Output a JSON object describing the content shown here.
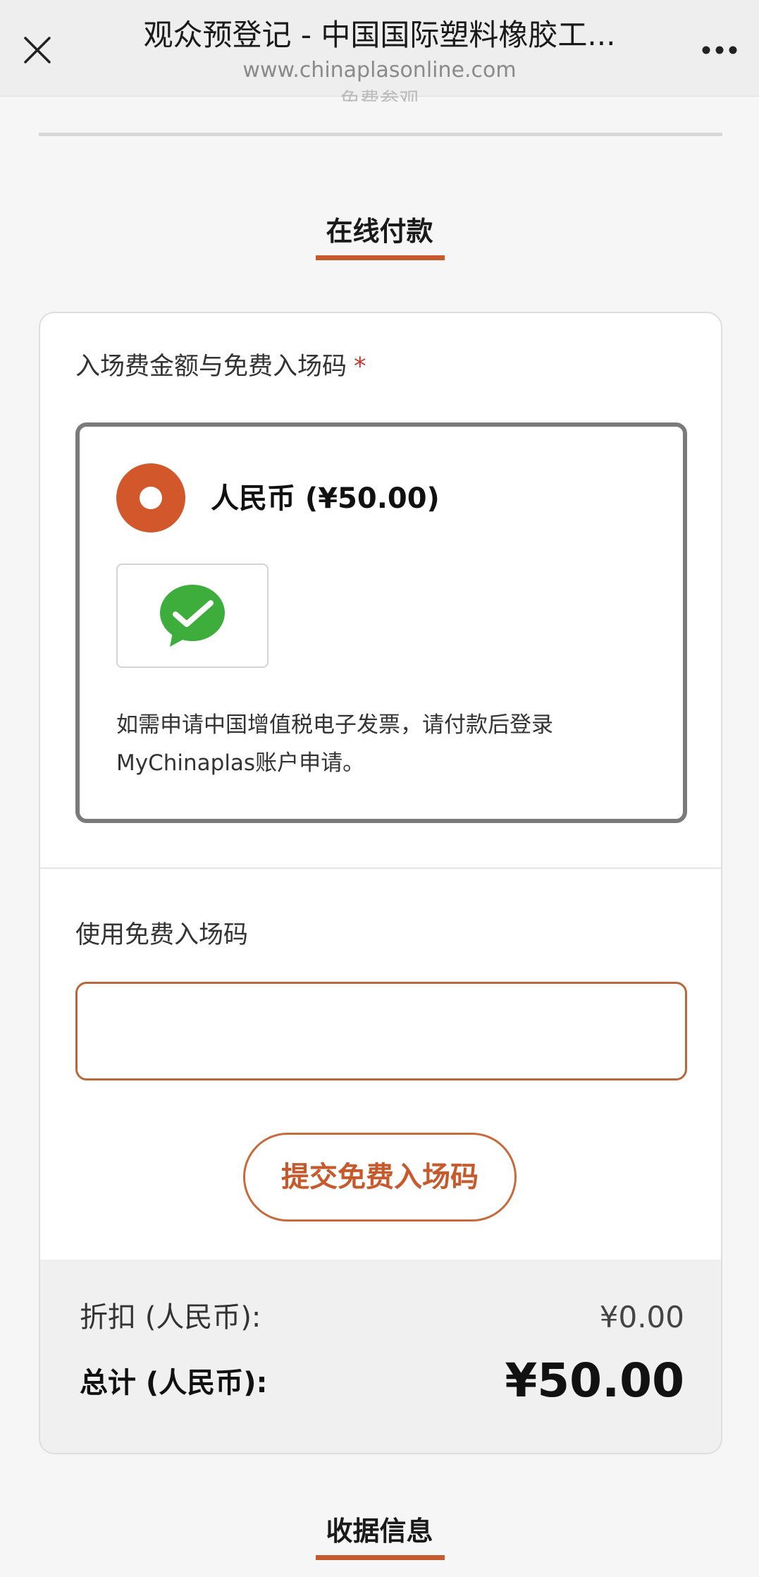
{
  "topbar": {
    "title": "观众预登记 - 中国国际塑料橡胶工...",
    "url": "www.chinaplasonline.com",
    "cutoff_text": "免费参观"
  },
  "payment": {
    "heading": "在线付款",
    "fee_label": "入场费金额与免费入场码",
    "required_mark": "*",
    "option_label": "人民币 (¥50.00)",
    "invoice_note": "如需申请中国增值税电子发票，请付款后登录MyChinaplas账户申请。",
    "free_code_label": "使用免费入场码",
    "free_code_value": "",
    "submit_label": "提交免费入场码"
  },
  "summary": {
    "discount_label": "折扣 (人民币):",
    "discount_value": "¥0.00",
    "total_label": "总计 (人民币):",
    "total_value": "¥50.00"
  },
  "receipt": {
    "heading": "收据信息"
  },
  "colors": {
    "accent": "#d2582b",
    "wechat_green": "#3dad3b"
  },
  "icons": {
    "close": "close-icon",
    "more": "more-dots-icon",
    "wechat": "wechat-pay-icon"
  }
}
